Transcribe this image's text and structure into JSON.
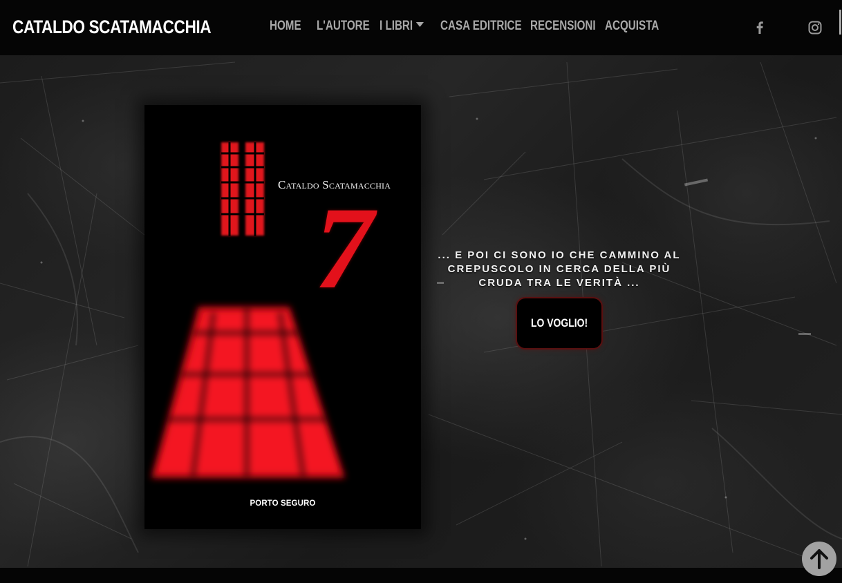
{
  "header": {
    "brand": "CATALDO SCATAMACCHIA",
    "nav": [
      {
        "label": "HOME"
      },
      {
        "label": "L'AUTORE"
      },
      {
        "label": "I LIBRI"
      },
      {
        "label": "CASA EDITRICE"
      },
      {
        "label": "RECENSIONI"
      },
      {
        "label": "ACQUISTA"
      }
    ],
    "social": [
      {
        "icon": "facebook-icon"
      },
      {
        "icon": "instagram-icon"
      }
    ]
  },
  "hero": {
    "cover": {
      "author": "Cataldo Scatamacchia",
      "title": "7",
      "publisher": "PORTO SEGURO"
    },
    "tagline": "... E POI CI SONO IO CHE CAMMINO AL CREPUSCOLO IN CERCA DELLA PIÙ CRUDA TRA LE VERITÀ ...",
    "cta_label": "LO VOGLIO!"
  },
  "colors": {
    "accent_red": "#e3111b",
    "nav_text": "#a8a8a8",
    "header_bg": "#050505"
  }
}
